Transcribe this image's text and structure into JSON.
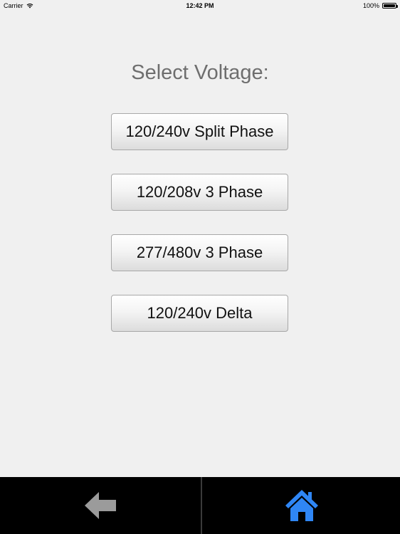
{
  "status_bar": {
    "carrier": "Carrier",
    "time": "12:42 PM",
    "battery": "100%",
    "battery_level": 1.0
  },
  "main": {
    "title": "Select Voltage:",
    "options": [
      {
        "label": "120/240v Split Phase"
      },
      {
        "label": "120/208v 3 Phase"
      },
      {
        "label": "277/480v 3 Phase"
      },
      {
        "label": "120/240v Delta"
      }
    ]
  },
  "bottom_bar": {
    "back_icon": "back-arrow-icon",
    "home_icon": "home-icon",
    "back_color": "#9b9b9b",
    "home_color": "#2f86f5"
  }
}
